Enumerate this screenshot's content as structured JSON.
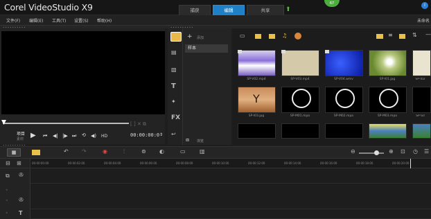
{
  "app": {
    "logo": "Corel VideoStudio X9",
    "badge": "67",
    "help": "i",
    "project_name": "未命名"
  },
  "tabs": [
    "捕获",
    "编辑",
    "共享"
  ],
  "menu": [
    "文件(F)",
    "编辑(E)",
    "工具(T)",
    "设置(S)",
    "帮助(H)"
  ],
  "player": {
    "project_label": "项目",
    "clip_label": "素材",
    "timecode": "00:00:00:0",
    "hd": "HD"
  },
  "library": {
    "add_label": "添加",
    "folder": "样本",
    "browse_label": "浏览",
    "items": [
      {
        "name": "SP-V02.mp4",
        "type": "video-purple"
      },
      {
        "name": "SP-V03.mp4",
        "type": "video-sand"
      },
      {
        "name": "SP-V04.wmv",
        "type": "video-blue"
      },
      {
        "name": "SP-I01.jpg",
        "type": "image-dandelion"
      },
      {
        "name": "SP-I02",
        "type": "image-light"
      },
      {
        "name": "SP-I03.jpg",
        "type": "image-tree"
      },
      {
        "name": "SP-M01.mpa",
        "type": "audio"
      },
      {
        "name": "SP-M02.mpa",
        "type": "audio"
      },
      {
        "name": "SP-M03.mpa",
        "type": "audio"
      },
      {
        "name": "SP-S0",
        "type": "audio"
      }
    ]
  },
  "timeline": {
    "ruler_ticks": [
      "00:00:00:00",
      "00:00:02:00",
      "00:00:04:00",
      "00:00:06:00",
      "00:00:08:00",
      "00:00:10:00",
      "00:00:12:00",
      "00:00:14:00",
      "00:00:16:00",
      "00:00:18:00",
      "00:00:20:00"
    ]
  }
}
